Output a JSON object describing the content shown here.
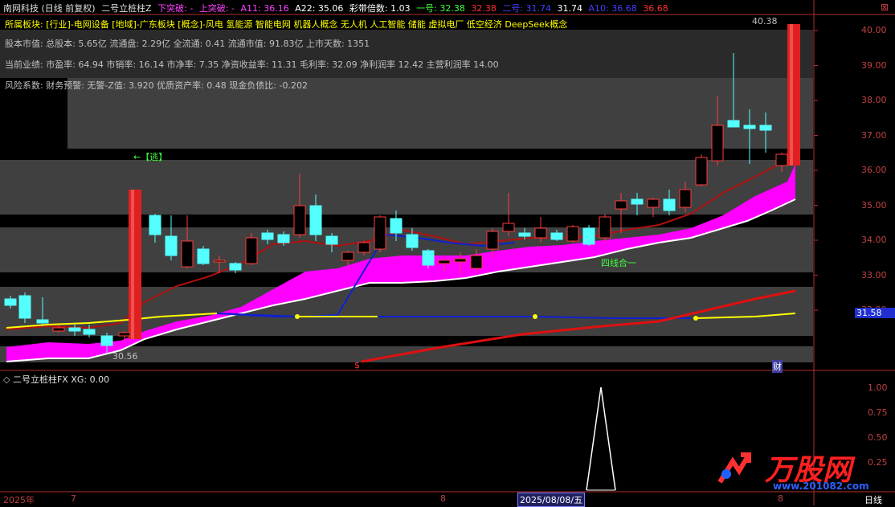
{
  "header": {
    "stock": "南网科技",
    "mode": "(日线 前复权)",
    "indicator": "二号立桩柱Z",
    "down_break": "下突破: -",
    "up_break": "上突破: -",
    "a11": "A11: 36.16",
    "a22": "A22: 35.06",
    "ribbon_mult": "彩带倍数: 1.03",
    "line1": "一号: 32.38",
    "line1b": "32.38",
    "line2": "二号: 31.74",
    "line2b": "31.74",
    "a10": "A10: 36.68",
    "a10b": "36.68"
  },
  "info": {
    "sector": "所属板块: [行业]-电网设备 [地域]-广东板块 [概念]-风电 氢能源 智能电网 机器人概念 无人机 人工智能 储能 虚拟电厂 低空经济 DeepSeek概念",
    "capital": "股本市值: 总股本: 5.65亿 流通盘: 2.29亿 全流通: 0.41 流通市值: 91.83亿 上市天数: 1351",
    "performance": "当前业绩: 市盈率: 64.94 市销率: 16.14 市净率: 7.35 净资收益率: 11.31 毛利率: 32.09 净利润率 12.42 主营利润率 14.00",
    "risk": "风险系数: 财务预警: 无警-Z值: 3.920 优质资产率: 0.48 现金负债比: -0.202"
  },
  "annotations": {
    "escape": "←【逃】",
    "four_line": "四线合一",
    "high": "40.38",
    "low": "30.56",
    "marker_s": "$",
    "marker_fin": "财",
    "current_price": "31.58"
  },
  "price_axis": [
    "40.00",
    "39.00",
    "38.00",
    "37.00",
    "36.00",
    "35.00",
    "34.00",
    "33.00",
    "32.00"
  ],
  "sub_panel": {
    "title": "二号立桩柱FX XG: 0.00",
    "axis": [
      "1.00",
      "0.75",
      "0.50",
      "0.25"
    ]
  },
  "footer": {
    "year": "2025年",
    "m7": "7",
    "m8": "8",
    "date": "2025/08/08/五",
    "m9": "8",
    "period": "日线"
  },
  "watermark": {
    "brand": "万股网",
    "url": "www.201082.com"
  },
  "colors": {
    "up": "#ff3b3b",
    "down": "#54ffff",
    "ribbon": "#ff00ff",
    "yellow": "#ffff00",
    "blue": "#1020d0",
    "band": "#404040"
  }
}
